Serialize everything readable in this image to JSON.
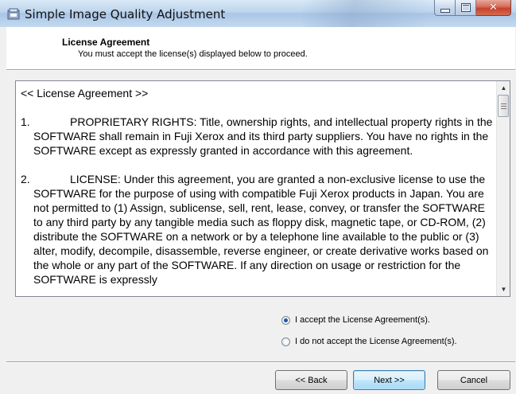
{
  "window": {
    "title": "Simple Image Quality Adjustment",
    "buttons": {
      "close_glyph": "✕"
    }
  },
  "header": {
    "title": "License Agreement",
    "subtitle": "You must accept the license(s) displayed below to proceed."
  },
  "license": {
    "heading": "<< License Agreement >>",
    "clauses": [
      {
        "num": "1.",
        "text": "PROPRIETARY RIGHTS: Title, ownership rights, and intellectual property rights in the SOFTWARE shall remain in Fuji Xerox and its third party suppliers.  You have no rights in the SOFTWARE except as expressly granted in accordance with this agreement."
      },
      {
        "num": "2.",
        "text": "LICENSE: Under this agreement, you are granted a non-exclusive license to use the SOFTWARE for the purpose of using with compatible Fuji Xerox products in Japan.  You are not permitted to (1) Assign, sublicense, sell, rent, lease, convey, or transfer the SOFTWARE to any third party by any tangible media such as floppy disk, magnetic tape, or CD-ROM, (2) distribute the SOFTWARE on a network or by a telephone line available to the public or (3) alter, modify, decompile, disassemble, reverse engineer, or create derivative works based on the whole or any part of the SOFTWARE.  If any direction on usage or restriction for the SOFTWARE is expressly"
      }
    ]
  },
  "options": {
    "accept_label": "I accept the License Agreement(s).",
    "decline_label": "I do not accept the License Agreement(s).",
    "selected": "accept"
  },
  "buttons": {
    "back": "<< Back",
    "next": "Next >>",
    "cancel": "Cancel"
  },
  "icons": {
    "app": "installer-icon",
    "minimize": "minimize-icon",
    "maximize": "maximize-icon",
    "close": "close-icon",
    "scroll_up": "scroll-up-arrow-icon",
    "scroll_down": "scroll-down-arrow-icon"
  },
  "scroll_up_glyph": "▲",
  "scroll_down_glyph": "▼"
}
